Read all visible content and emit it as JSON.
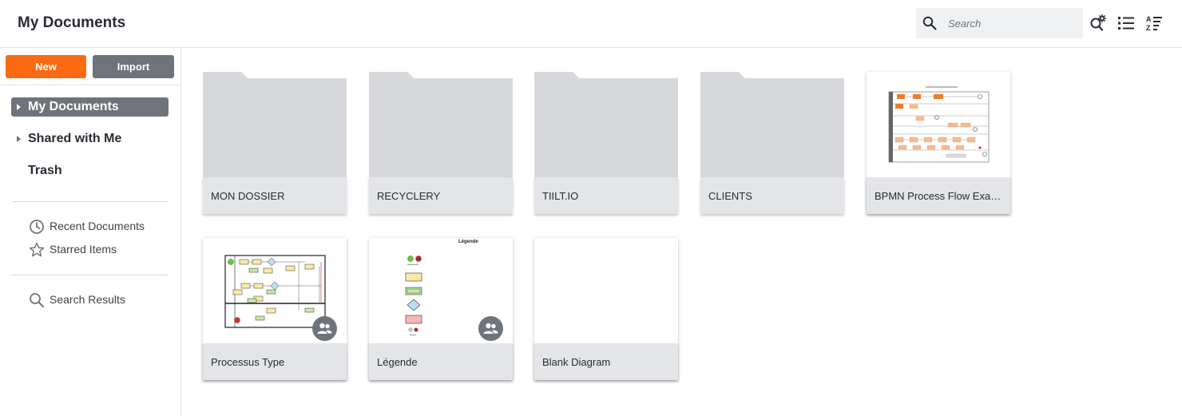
{
  "header": {
    "title": "My Documents",
    "search_placeholder": "Search"
  },
  "sidebar": {
    "new_label": "New",
    "import_label": "Import",
    "nav": [
      {
        "label": "My Documents",
        "active": true
      },
      {
        "label": "Shared with Me"
      },
      {
        "label": "Trash"
      }
    ],
    "links": [
      {
        "label": "Recent Documents",
        "icon": "clock-icon"
      },
      {
        "label": "Starred Items",
        "icon": "star-icon"
      },
      {
        "label": "Search Results",
        "icon": "search-icon"
      }
    ]
  },
  "items": [
    {
      "type": "folder",
      "name": "MON DOSSIER"
    },
    {
      "type": "folder",
      "name": "RECYCLERY"
    },
    {
      "type": "folder",
      "name": "TIILT.IO"
    },
    {
      "type": "folder",
      "name": "CLIENTS"
    },
    {
      "type": "document",
      "name": "BPMN Process Flow Example"
    },
    {
      "type": "document",
      "name": "Processus Type",
      "shared": true
    },
    {
      "type": "document",
      "name": "Légende",
      "shared": true,
      "thumb_title": "Légende"
    },
    {
      "type": "document",
      "name": "Blank Diagram"
    }
  ],
  "colors": {
    "accent": "#f96b13",
    "secondary": "#6f737a",
    "folder": "#d6d8dc",
    "card_label_bg": "#e3e5e8"
  }
}
